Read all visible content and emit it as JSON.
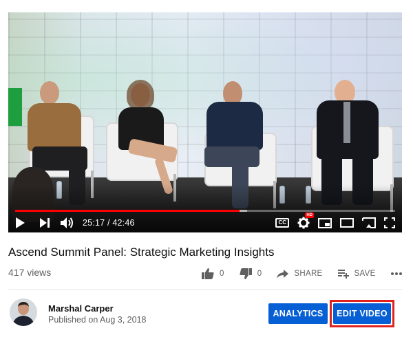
{
  "player": {
    "current_time": "25:17",
    "time_separator": "/",
    "duration": "42:46",
    "progress_fraction": 0.59,
    "buffer_fraction": 0.61,
    "progress_color": "#ff0000",
    "hd_badge": "HD",
    "cc_label": "CC"
  },
  "video": {
    "title": "Ascend Summit Panel: Strategic Marketing Insights",
    "views": "417 views",
    "likes": "0",
    "dislikes": "0",
    "share_label": "SHARE",
    "save_label": "SAVE"
  },
  "channel": {
    "name": "Marshal Carper",
    "published": "Published on Aug 3, 2018"
  },
  "buttons": {
    "analytics_label": "ANALYTICS",
    "edit_video_label": "EDIT VIDEO",
    "button_color": "#065fd4",
    "highlight_color": "#e0211c"
  },
  "icons": {
    "play": "play-icon",
    "next": "next-icon",
    "volume": "volume-icon",
    "captions": "captions-icon",
    "settings": "gear-icon",
    "miniplayer": "miniplayer-icon",
    "theater": "theater-mode-icon",
    "cast": "cast-icon",
    "fullscreen": "fullscreen-icon",
    "like": "thumbs-up-icon",
    "dislike": "thumbs-down-icon",
    "share": "share-arrow-icon",
    "save": "playlist-add-icon",
    "more": "more-horizontal-icon"
  }
}
